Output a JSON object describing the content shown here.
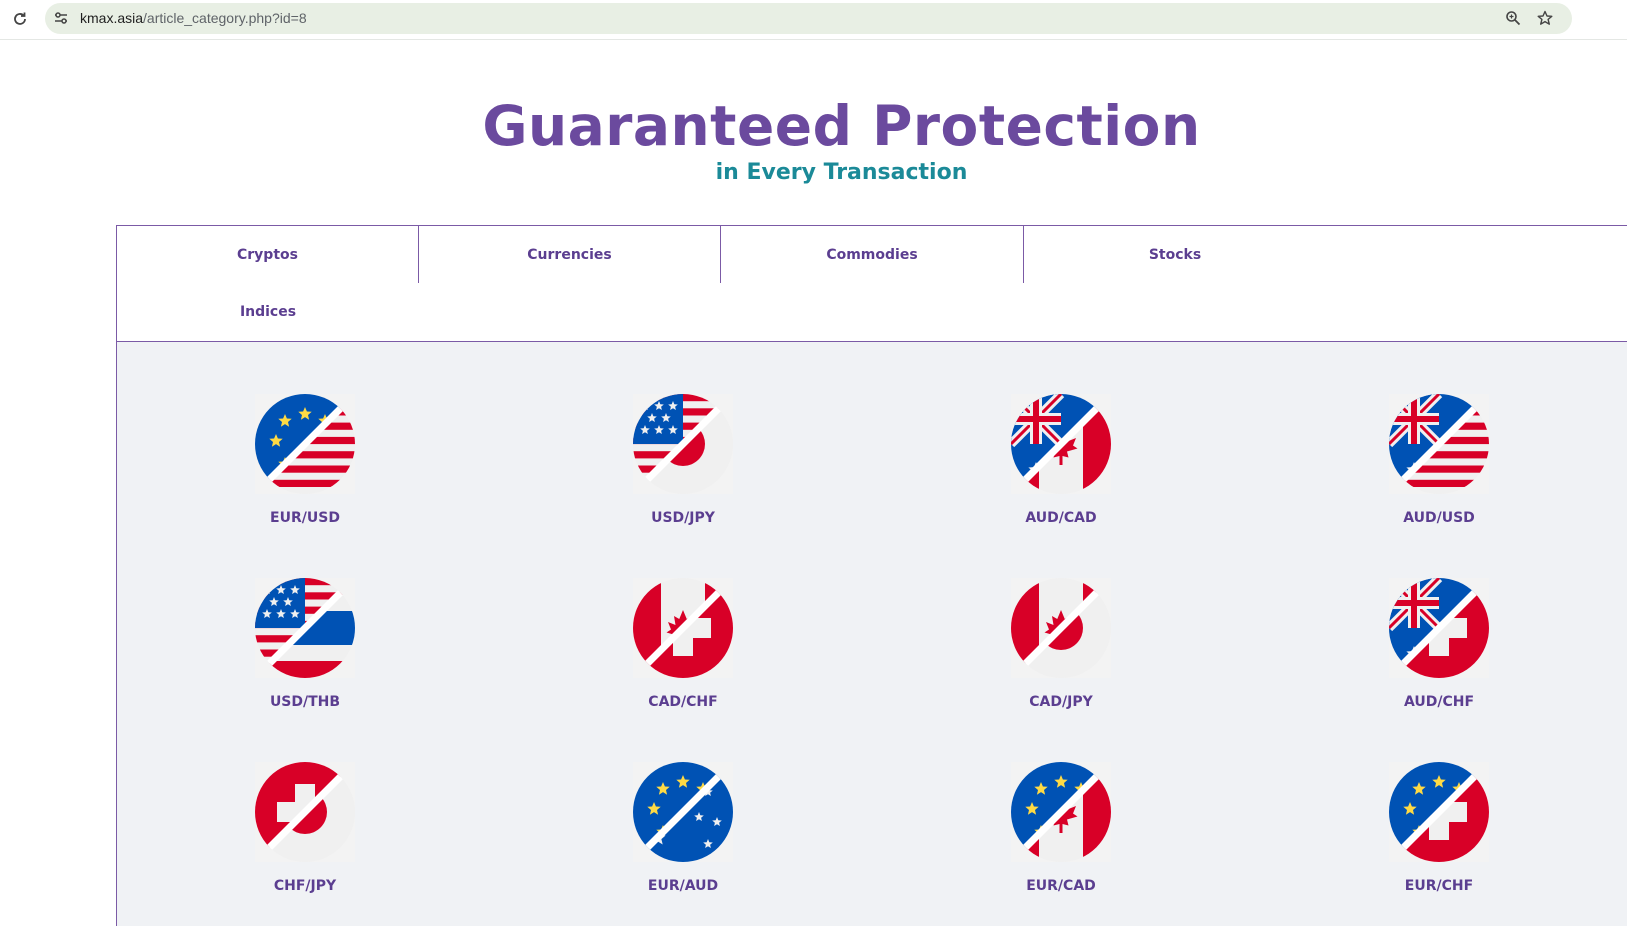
{
  "browser": {
    "url_domain": "kmax.asia",
    "url_path": "/article_category.php?id=8",
    "icons": [
      "reload-icon",
      "site-info-icon",
      "zoom-icon",
      "star-icon"
    ]
  },
  "hero": {
    "title": "Guaranteed Protection",
    "subtitle": "in Every Transaction"
  },
  "tabs": [
    {
      "label": "Cryptos"
    },
    {
      "label": "Currencies"
    },
    {
      "label": "Commodies"
    },
    {
      "label": "Stocks"
    },
    {
      "label": "Indices"
    }
  ],
  "colors": {
    "brand_purple": "#6b4a9e",
    "subtitle_teal": "#1b8a98",
    "panel_bg": "#f0f2f5"
  },
  "pairs": [
    {
      "label": "EUR/USD",
      "base": "eu",
      "quote": "us"
    },
    {
      "label": "USD/JPY",
      "base": "us",
      "quote": "jp"
    },
    {
      "label": "AUD/CAD",
      "base": "au",
      "quote": "ca"
    },
    {
      "label": "AUD/USD",
      "base": "au",
      "quote": "us"
    },
    {
      "label": "USD/THB",
      "base": "us",
      "quote": "th"
    },
    {
      "label": "CAD/CHF",
      "base": "ca",
      "quote": "ch"
    },
    {
      "label": "CAD/JPY",
      "base": "ca",
      "quote": "jp"
    },
    {
      "label": "AUD/CHF",
      "base": "au",
      "quote": "ch"
    },
    {
      "label": "CHF/JPY",
      "base": "ch",
      "quote": "jp"
    },
    {
      "label": "EUR/AUD",
      "base": "eu",
      "quote": "au"
    },
    {
      "label": "EUR/CAD",
      "base": "eu",
      "quote": "ca"
    },
    {
      "label": "EUR/CHF",
      "base": "eu",
      "quote": "ch"
    }
  ]
}
